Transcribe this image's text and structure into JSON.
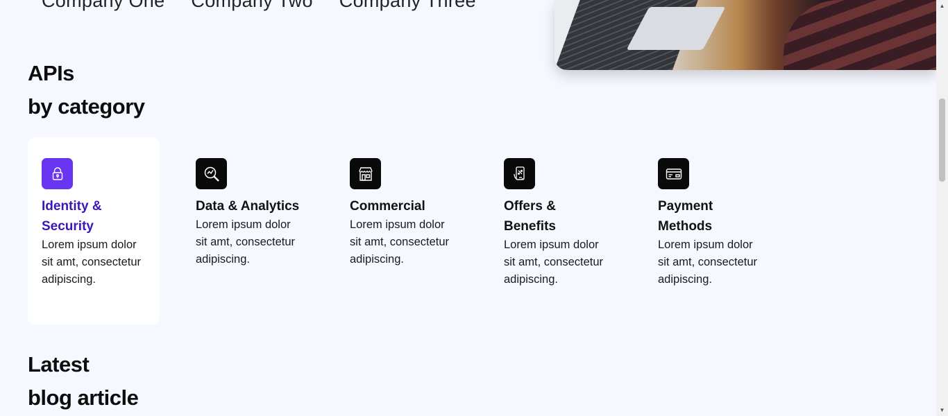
{
  "companies": [
    "Company One",
    "Company Two",
    "Company Three"
  ],
  "apis_section": {
    "title_line1": "APIs",
    "title_line2": "by category"
  },
  "categories": [
    {
      "title": "Identity & Security",
      "description": "Lorem ipsum dolor sit amt, consectetur adipiscing.",
      "icon": "lock-icon",
      "active": true
    },
    {
      "title": "Data & Analytics",
      "description": "Lorem ipsum dolor sit amt, consectetur adipiscing.",
      "icon": "analytics-icon",
      "active": false
    },
    {
      "title": "Commercial",
      "description": "Lorem ipsum dolor sit amt, consectetur adipiscing.",
      "icon": "storefront-icon",
      "active": false
    },
    {
      "title": "Offers & Benefits",
      "description": "Lorem ipsum dolor sit amt, consectetur adipiscing.",
      "icon": "mobile-offer-icon",
      "active": false
    },
    {
      "title": "Payment Methods",
      "description": "Lorem ipsum dolor sit amt, consectetur adipiscing.",
      "icon": "credit-card-icon",
      "active": false
    }
  ],
  "blog_section": {
    "title_line1": "Latest",
    "title_line2": "blog article"
  },
  "colors": {
    "background": "#f5f9ff",
    "accent": "#6a35f0",
    "active_title": "#3b17b8",
    "icon_bg": "#0a0a0a"
  }
}
